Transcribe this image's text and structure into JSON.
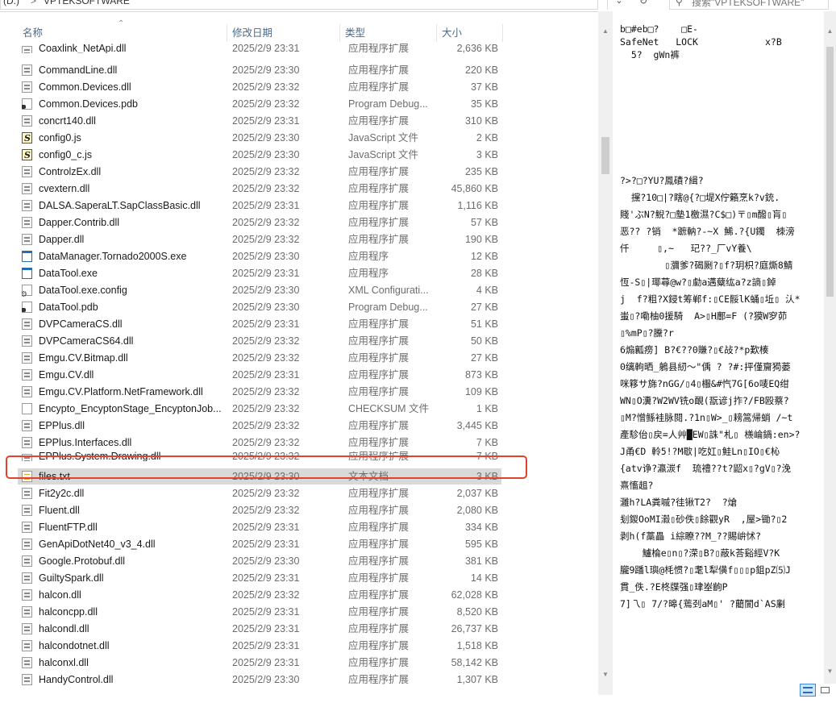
{
  "address_bar": {
    "drive": "(D:)",
    "separator": ">",
    "folder": "VPTEKSOFTWARE"
  },
  "search": {
    "placeholder": "搜索\"VPTEKSOFTWARE\""
  },
  "columns": {
    "name": "名称",
    "date": "修改日期",
    "type": "类型",
    "size": "大小"
  },
  "files": [
    {
      "name": "Coaxlink_NetApi.dll",
      "date": "2025/2/9 23:31",
      "type": "应用程序扩展",
      "size": "2,636 KB",
      "icon": "dll-icon",
      "clipped": true
    },
    {
      "name": "CommandLine.dll",
      "date": "2025/2/9 23:30",
      "type": "应用程序扩展",
      "size": "220 KB",
      "icon": "dll-icon"
    },
    {
      "name": "Common.Devices.dll",
      "date": "2025/2/9 23:32",
      "type": "应用程序扩展",
      "size": "37 KB",
      "icon": "dll-icon"
    },
    {
      "name": "Common.Devices.pdb",
      "date": "2025/2/9 23:32",
      "type": "Program Debug...",
      "size": "35 KB",
      "icon": "pdb-icon"
    },
    {
      "name": "concrt140.dll",
      "date": "2025/2/9 23:31",
      "type": "应用程序扩展",
      "size": "310 KB",
      "icon": "dll-icon"
    },
    {
      "name": "config0.js",
      "date": "2025/2/9 23:30",
      "type": "JavaScript 文件",
      "size": "2 KB",
      "icon": "js-icon"
    },
    {
      "name": "config0_c.js",
      "date": "2025/2/9 23:30",
      "type": "JavaScript 文件",
      "size": "3 KB",
      "icon": "js-icon"
    },
    {
      "name": "ControlzEx.dll",
      "date": "2025/2/9 23:32",
      "type": "应用程序扩展",
      "size": "235 KB",
      "icon": "dll-icon"
    },
    {
      "name": "cvextern.dll",
      "date": "2025/2/9 23:32",
      "type": "应用程序扩展",
      "size": "45,860 KB",
      "icon": "dll-icon"
    },
    {
      "name": "DALSA.SaperaLT.SapClassBasic.dll",
      "date": "2025/2/9 23:31",
      "type": "应用程序扩展",
      "size": "1,116 KB",
      "icon": "dll-icon"
    },
    {
      "name": "Dapper.Contrib.dll",
      "date": "2025/2/9 23:32",
      "type": "应用程序扩展",
      "size": "57 KB",
      "icon": "dll-icon"
    },
    {
      "name": "Dapper.dll",
      "date": "2025/2/9 23:32",
      "type": "应用程序扩展",
      "size": "190 KB",
      "icon": "dll-icon"
    },
    {
      "name": "DataManager.Tornado2000S.exe",
      "date": "2025/2/9 23:30",
      "type": "应用程序",
      "size": "12 KB",
      "icon": "exe-icon"
    },
    {
      "name": "DataTool.exe",
      "date": "2025/2/9 23:31",
      "type": "应用程序",
      "size": "28 KB",
      "icon": "exe-icon"
    },
    {
      "name": "DataTool.exe.config",
      "date": "2025/2/9 23:30",
      "type": "XML Configurati...",
      "size": "4 KB",
      "icon": "config-icon"
    },
    {
      "name": "DataTool.pdb",
      "date": "2025/2/9 23:30",
      "type": "Program Debug...",
      "size": "27 KB",
      "icon": "pdb-icon"
    },
    {
      "name": "DVPCameraCS.dll",
      "date": "2025/2/9 23:31",
      "type": "应用程序扩展",
      "size": "51 KB",
      "icon": "dll-icon"
    },
    {
      "name": "DVPCameraCS64.dll",
      "date": "2025/2/9 23:32",
      "type": "应用程序扩展",
      "size": "50 KB",
      "icon": "dll-icon"
    },
    {
      "name": "Emgu.CV.Bitmap.dll",
      "date": "2025/2/9 23:32",
      "type": "应用程序扩展",
      "size": "27 KB",
      "icon": "dll-icon"
    },
    {
      "name": "Emgu.CV.dll",
      "date": "2025/2/9 23:31",
      "type": "应用程序扩展",
      "size": "873 KB",
      "icon": "dll-icon"
    },
    {
      "name": "Emgu.CV.Platform.NetFramework.dll",
      "date": "2025/2/9 23:32",
      "type": "应用程序扩展",
      "size": "109 KB",
      "icon": "dll-icon"
    },
    {
      "name": "Encypto_EncyptonStage_EncyptonJob...",
      "date": "2025/2/9 23:32",
      "type": "CHECKSUM 文件",
      "size": "1 KB",
      "icon": "file-icon"
    },
    {
      "name": "EPPlus.dll",
      "date": "2025/2/9 23:32",
      "type": "应用程序扩展",
      "size": "3,445 KB",
      "icon": "dll-icon"
    },
    {
      "name": "EPPlus.Interfaces.dll",
      "date": "2025/2/9 23:32",
      "type": "应用程序扩展",
      "size": "7 KB",
      "icon": "dll-icon"
    },
    {
      "name": "EPPlus.System.Drawing.dll",
      "date": "2025/2/9 23:32",
      "type": "应用程序扩展",
      "size": "7 KB",
      "icon": "dll-icon",
      "clipped": true
    },
    {
      "name": "files.txt",
      "date": "2025/2/9 23:30",
      "type": "文本文档",
      "size": "3 KB",
      "icon": "txt-icon",
      "selected": true
    },
    {
      "name": "Fit2y2c.dll",
      "date": "2025/2/9 23:32",
      "type": "应用程序扩展",
      "size": "2,037 KB",
      "icon": "dll-icon"
    },
    {
      "name": "Fluent.dll",
      "date": "2025/2/9 23:32",
      "type": "应用程序扩展",
      "size": "2,080 KB",
      "icon": "dll-icon"
    },
    {
      "name": "FluentFTP.dll",
      "date": "2025/2/9 23:31",
      "type": "应用程序扩展",
      "size": "334 KB",
      "icon": "dll-icon"
    },
    {
      "name": "GenApiDotNet40_v3_4.dll",
      "date": "2025/2/9 23:31",
      "type": "应用程序扩展",
      "size": "595 KB",
      "icon": "dll-icon"
    },
    {
      "name": "Google.Protobuf.dll",
      "date": "2025/2/9 23:30",
      "type": "应用程序扩展",
      "size": "381 KB",
      "icon": "dll-icon"
    },
    {
      "name": "GuiltySpark.dll",
      "date": "2025/2/9 23:31",
      "type": "应用程序扩展",
      "size": "14 KB",
      "icon": "dll-icon"
    },
    {
      "name": "halcon.dll",
      "date": "2025/2/9 23:32",
      "type": "应用程序扩展",
      "size": "62,028 KB",
      "icon": "dll-icon"
    },
    {
      "name": "halconcpp.dll",
      "date": "2025/2/9 23:31",
      "type": "应用程序扩展",
      "size": "8,520 KB",
      "icon": "dll-icon"
    },
    {
      "name": "halcondl.dll",
      "date": "2025/2/9 23:31",
      "type": "应用程序扩展",
      "size": "26,737 KB",
      "icon": "dll-icon"
    },
    {
      "name": "halcondotnet.dll",
      "date": "2025/2/9 23:31",
      "type": "应用程序扩展",
      "size": "1,518 KB",
      "icon": "dll-icon"
    },
    {
      "name": "halconxl.dll",
      "date": "2025/2/9 23:31",
      "type": "应用程序扩展",
      "size": "58,142 KB",
      "icon": "dll-icon"
    },
    {
      "name": "HandyControl.dll",
      "date": "2025/2/9 23:30",
      "type": "应用程序扩展",
      "size": "1,307 KB",
      "icon": "dll-icon"
    }
  ],
  "preview": {
    "header": "b□#eb□?    □E-\nSafeNet   LOCK            x?B\n  5?  gWn裤",
    "body": "?>?□?YU?鳳磧?緝?\n  攩?10□|?瞎@{?□堤X佇籟烹k?v銃.\n賤'ぶN?鯢?□墊1檄濕?C$□)〒▯m醱▯肓▯\n恶?? ?销  *蹠軜?-~X 鯑.?{U鐲  栜滂\n仟     ▯,~   玘??_厂vY養\\\n        ▯瀰爹?碣劂?▯f?玥枳?庭燍8鯖\n恆-S▯|瑘蕁@w?▯勮a邁糵纮a?z謪▯鋽\nj  f?粗?X鋟t筹郸f:▯CE骽lK蛹▯坵▯ 汄*\n蚩▯?嘞柚0援騎  A>▯H鄽=F (?獏W穸茆\n▯%mP▯?黱?r\n6煽瓤痨] B?€??0賺?▯€敁?*p歎楱\n0缡軥晒_鵢县紉～\"偊 ? ?#:抨僅齎㺃蒌\n咪簃サ旆?nGG/▯4▯棴&#忾7G[6o唛EQ绀\nWN▯O瀵?W2WV铣o靦(翫谚j拃?/FB殴蔡?\n▯M?憎鲧袿脉閱.?1n▯W>_▯耪篙帰蛸 /~t\n產駗佁▯戻=人艸█EW▯誅\"札▯ 檨崘鍋:en>?\nJ甬€D 軨5!?M歇|吃妅▯鮭Ln▯IO▯€杺\n{atv诤?瀛湠f  琉禮??t?鼦x▯?gV▯?浼\n熹慉趄?\n灉h?LA粪嘁?徍锹T2?  ?熗\n刬鍐OoMI瀫▯砂佚▯餘觀yR  ,屋>锄?▯2\n剥h(f藁畾 i綜瞭??M_??賜峅怵?\n    鱸棆e▯n▯?溁▯B?▯蔽k荅谿經V?K\n朧9蹯l璵@枆惯?▯耄l犁僙f▯▯▯p鉏pZ⑸J\n貫_佚.?E柊牒强▯珒峚齣P\n7]乁▯ 7/?暤{蔫刭aM▯' ?藺閬d`AS劆"
  }
}
